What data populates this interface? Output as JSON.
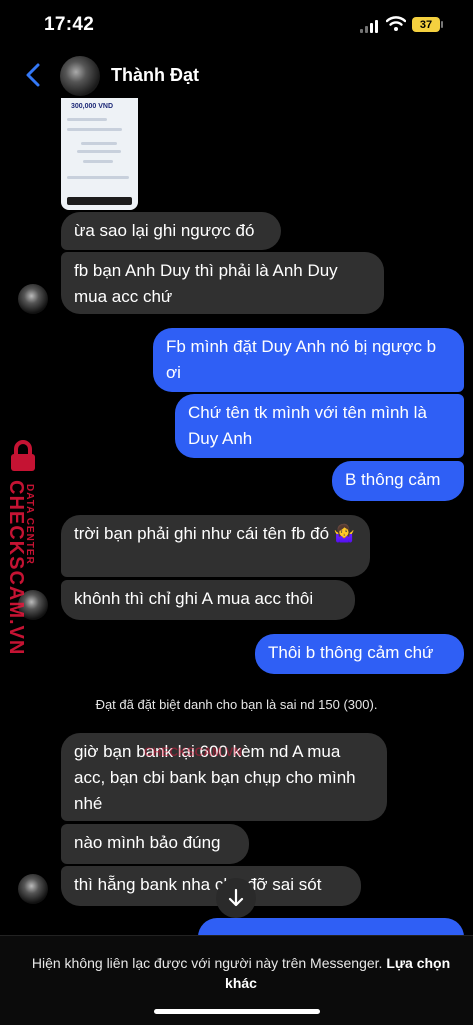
{
  "status_bar": {
    "time": "17:42",
    "battery": "37"
  },
  "header": {
    "contact_name": "Thành Đạt"
  },
  "shared_image": {
    "amount_text": "300,000 VND"
  },
  "messages": [
    {
      "dir": "in",
      "text": "ừa sao lại ghi ngược đó"
    },
    {
      "dir": "in",
      "text": "fb bạn Anh Duy thì phải là Anh Duy mua acc chứ"
    },
    {
      "dir": "out",
      "text": "Fb mình đặt Duy Anh nó bị ngược b ơi"
    },
    {
      "dir": "out",
      "text": "Chứ tên tk mình với tên mình là Duy Anh"
    },
    {
      "dir": "out",
      "text": "B thông cảm"
    },
    {
      "dir": "in",
      "text": "trời bạn phải ghi như cái tên fb đó 🤷‍♀️"
    },
    {
      "dir": "in",
      "text": "khônh thì chỉ ghi A mua acc thôi"
    },
    {
      "dir": "out",
      "text": "Thôi b thông cảm chứ"
    },
    {
      "dir": "in",
      "text": "giờ bạn bank lại 600 kèm nd A mua acc, bạn cbi bank bạn chụp cho mình nhé"
    },
    {
      "dir": "in",
      "text": "nào mình bảo đúng"
    },
    {
      "dir": "in",
      "text": "thì hẵng bank nha cho đỡ sai sót"
    }
  ],
  "system_notice": "Đạt đã đặt biệt danh cho bạn là sai nd 150 (300).",
  "watermark": {
    "small": "DATA CENTER",
    "large": "CHECKSCAM.VN",
    "center": "CHECKSCAM.VN"
  },
  "footer": {
    "text": "Hiện không liên lạc được với người này trên Messenger.",
    "link": "Lựa chọn khác"
  },
  "icons": {
    "back": "chevron-left-icon",
    "scroll": "arrow-down-icon",
    "wifi": "wifi-icon",
    "signal": "signal-icon",
    "lock": "lock-icon"
  },
  "colors": {
    "outgoing": "#2f5ff5",
    "incoming": "#303030",
    "back_arrow": "#3478f6"
  }
}
